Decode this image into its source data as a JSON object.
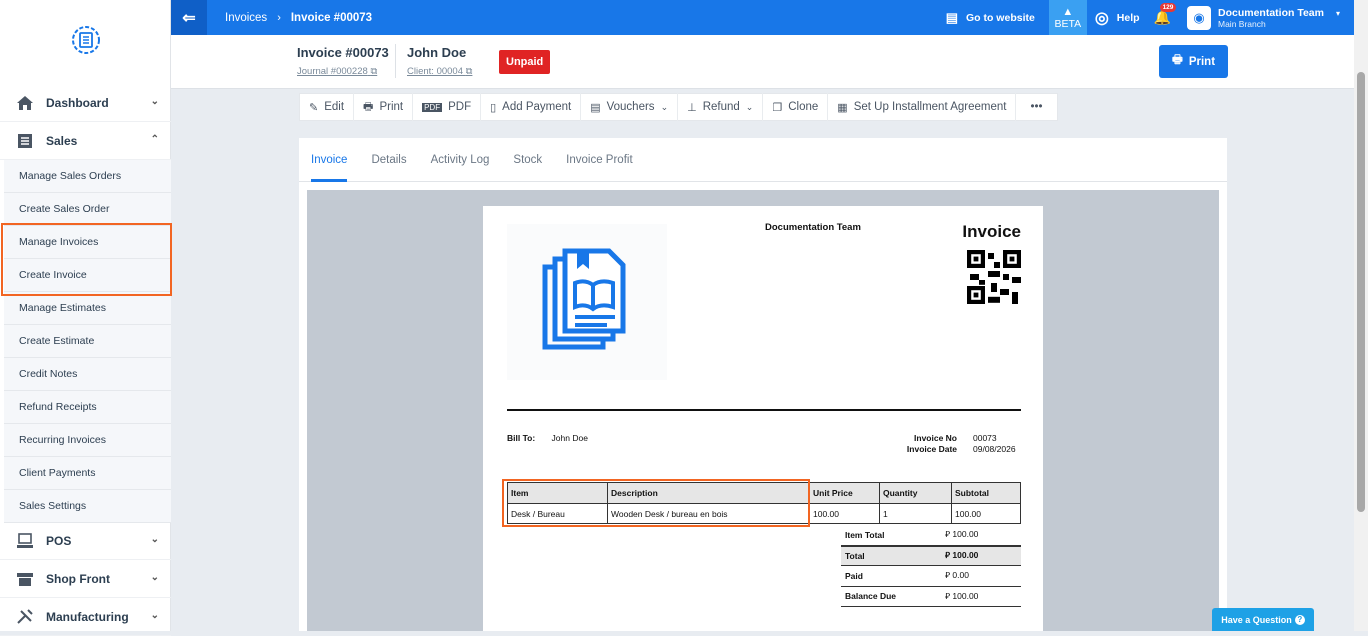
{
  "sidebar": {
    "main_items": [
      {
        "label": "Dashboard",
        "icon": "home-icon",
        "chevron": "⌄"
      },
      {
        "label": "Sales",
        "icon": "list-icon",
        "chevron": "⌃"
      },
      {
        "label": "POS",
        "icon": "pos-icon",
        "chevron": "⌄"
      },
      {
        "label": "Shop Front",
        "icon": "shop-icon",
        "chevron": "⌄"
      },
      {
        "label": "Manufacturing",
        "icon": "tools-icon",
        "chevron": "⌄"
      }
    ],
    "sales_submenu": [
      "Manage Sales Orders",
      "Create Sales Order",
      "Manage Invoices",
      "Create Invoice",
      "Manage Estimates",
      "Create Estimate",
      "Credit Notes",
      "Refund Receipts",
      "Recurring Invoices",
      "Client Payments",
      "Sales Settings"
    ]
  },
  "topbar": {
    "breadcrumb": [
      "Invoices",
      "Invoice #00073"
    ],
    "go_to_website": "Go to website",
    "beta": "BETA",
    "help": "Help",
    "notification_count": "129",
    "team_name": "Documentation Team",
    "branch": "Main Branch",
    "colors": {
      "bar": "#1877e8",
      "accent": "#3aa0f2"
    }
  },
  "header": {
    "invoice_title": "Invoice #00073",
    "journal_link": "Journal #000228",
    "client_name": "John Doe",
    "client_link": "Client: 00004",
    "status": "Unpaid",
    "status_color": "#e02424",
    "print_label": "Print"
  },
  "actions": [
    {
      "label": "Edit",
      "icon": "pencil-icon",
      "dropdown": false
    },
    {
      "label": "Print",
      "icon": "printer-icon",
      "dropdown": false
    },
    {
      "label": "PDF",
      "icon": "pdf-icon",
      "dropdown": false
    },
    {
      "label": "Add Payment",
      "icon": "payment-icon",
      "dropdown": false
    },
    {
      "label": "Vouchers",
      "icon": "voucher-icon",
      "dropdown": true
    },
    {
      "label": "Refund",
      "icon": "refund-icon",
      "dropdown": true
    },
    {
      "label": "Clone",
      "icon": "clone-icon",
      "dropdown": false
    },
    {
      "label": "Set Up Installment Agreement",
      "icon": "installment-icon",
      "dropdown": false
    },
    {
      "label": "•••",
      "icon": "",
      "dropdown": false
    }
  ],
  "tabs": [
    "Invoice",
    "Details",
    "Activity Log",
    "Stock",
    "Invoice Profit"
  ],
  "invoice_doc": {
    "company": "Documentation Team",
    "heading": "Invoice",
    "bill_to_label": "Bill To:",
    "bill_to_name": "John Doe",
    "invoice_no_label": "Invoice No",
    "invoice_no": "00073",
    "invoice_date_label": "Invoice Date",
    "invoice_date": "09/08/2026",
    "columns": [
      "Item",
      "Description",
      "Unit Price",
      "Quantity",
      "Subtotal"
    ],
    "rows": [
      [
        "Desk / Bureau",
        "Wooden Desk / bureau en bois",
        "100.00",
        "1",
        "100.00"
      ]
    ],
    "totals": [
      {
        "label": "Item Total",
        "value": "⃁ 100.00"
      },
      {
        "label": "Total",
        "value": "⃁ 100.00"
      },
      {
        "label": "Paid",
        "value": "⃁ 0.00"
      },
      {
        "label": "Balance Due",
        "value": "⃁ 100.00"
      }
    ]
  },
  "help_widget": "Have a Question"
}
